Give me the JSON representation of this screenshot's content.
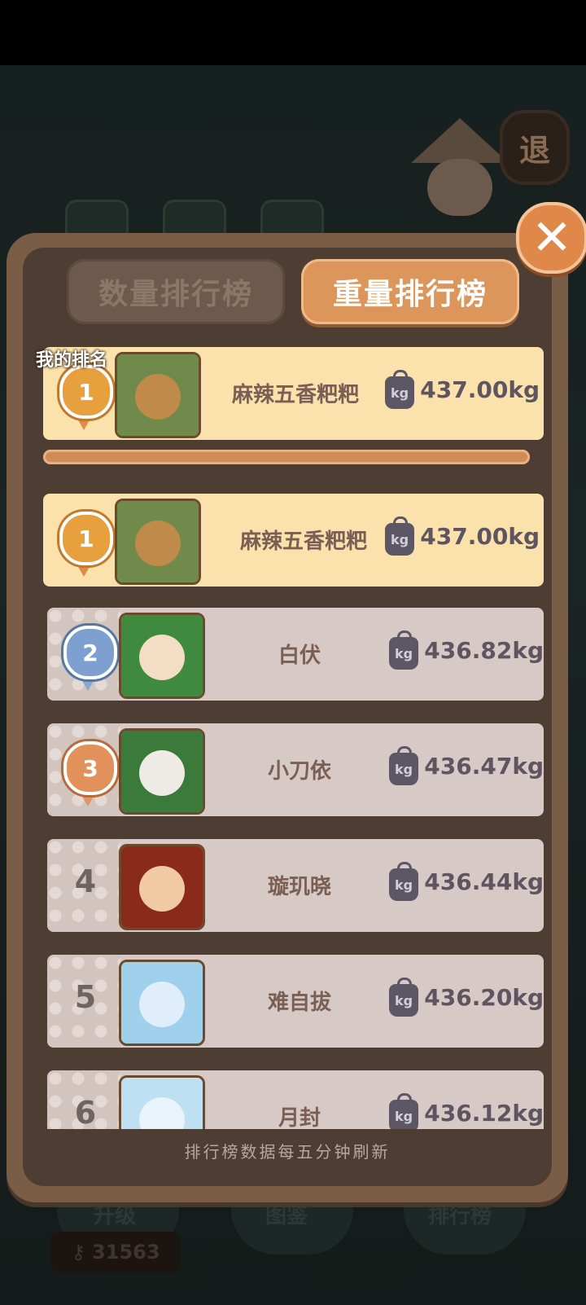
{
  "background": {
    "exit_label": "退",
    "bottom_buttons": [
      "升级",
      "图鉴",
      "排行榜"
    ],
    "coins": "31563"
  },
  "tabs": {
    "count": "数量排行榜",
    "weight": "重量排行榜",
    "active": "weight"
  },
  "my_rank": {
    "label": "我的排名",
    "rank": "1",
    "name": "麻辣五香粑粑",
    "weight": "437.00kg"
  },
  "weight_unit_icon": "kg",
  "leaderboard": [
    {
      "rank": "1",
      "name": "麻辣五香粑粑",
      "weight": "437.00kg",
      "medal": "gold"
    },
    {
      "rank": "2",
      "name": "白伏",
      "weight": "436.82kg",
      "medal": "silver"
    },
    {
      "rank": "3",
      "name": "小刀依",
      "weight": "436.47kg",
      "medal": "bronze"
    },
    {
      "rank": "4",
      "name": "璇玑晓",
      "weight": "436.44kg",
      "medal": ""
    },
    {
      "rank": "5",
      "name": "难自拔",
      "weight": "436.20kg",
      "medal": ""
    },
    {
      "rank": "6",
      "name": "月封",
      "weight": "436.12kg",
      "medal": ""
    }
  ],
  "footer_note": "排行榜数据每五分钟刷新",
  "colors": {
    "accent": "#dc965c",
    "panel": "#7a5d47",
    "gold_row": "#fbe2ad",
    "row": "#d7cac6"
  }
}
